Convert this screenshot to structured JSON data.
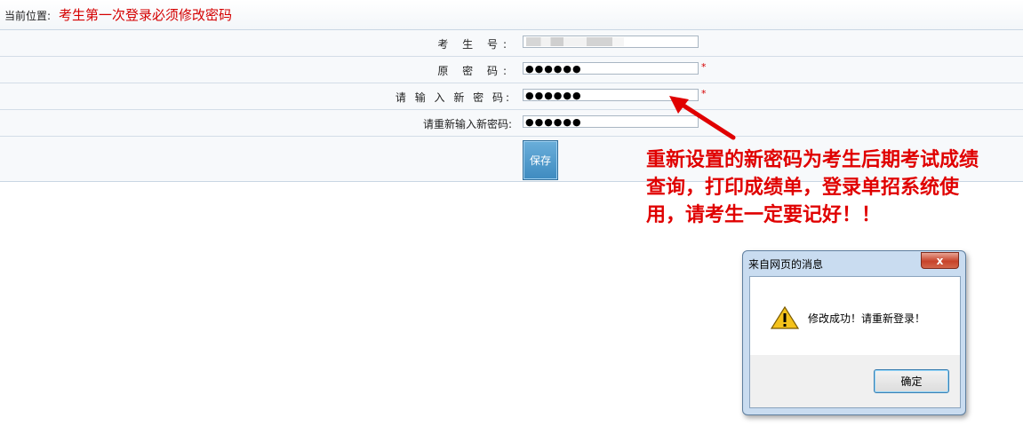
{
  "breadcrumb": {
    "label": "当前位置:",
    "title": "考生第一次登录必须修改密码"
  },
  "form": {
    "exam_number_label": "考 生 号:",
    "old_password_label": "原 密 码:",
    "old_password_value": "●●●●●●",
    "new_password_label": "请 输 入 新 密 码:",
    "new_password_value": "●●●●●●",
    "confirm_password_label": "请重新输入新密码:",
    "confirm_password_value": "●●●●●●",
    "required_mark": "*",
    "save_label": "保存"
  },
  "annotation": {
    "text": "重新设置的新密码为考生后期考试成绩查询，打印成绩单，登录单招系统使用，请考生一定要记好！！",
    "color": "#e00000"
  },
  "dialog": {
    "title": "来自网页的消息",
    "close_label": "x",
    "message": "修改成功！请重新登录！",
    "icon": "warning-icon",
    "ok_label": "确定"
  },
  "colors": {
    "accent_red": "#d40000",
    "button_blue": "#4a94c8"
  }
}
